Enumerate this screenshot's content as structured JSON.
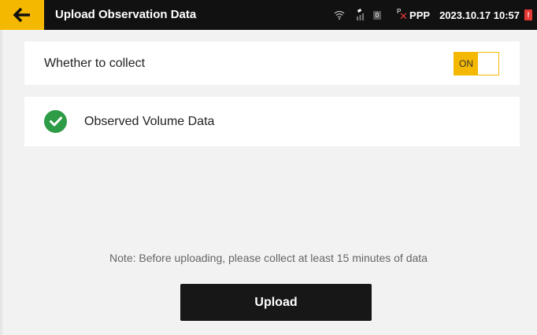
{
  "header": {
    "title": "Upload Observation Data",
    "back_icon": "arrow-left-icon",
    "accent_color": "#f5b800"
  },
  "status_bar": {
    "wifi_icon": "wifi-icon",
    "satellite_icon": "satellite-signal-icon",
    "satellite_count": "0",
    "ppp_label": "PPP",
    "ppp_status_icon": "ppp-disconnected-icon",
    "datetime": "2023.10.17 10:57",
    "battery_icon": "battery-low-icon"
  },
  "collect": {
    "label": "Whether to collect",
    "toggle_state": "ON"
  },
  "volume": {
    "label": "Observed Volume Data",
    "status_icon": "check-circle-icon",
    "status_color": "#2e9b47"
  },
  "note": "Note: Before uploading, please collect at least 15 minutes of data",
  "upload_button": {
    "label": "Upload"
  }
}
